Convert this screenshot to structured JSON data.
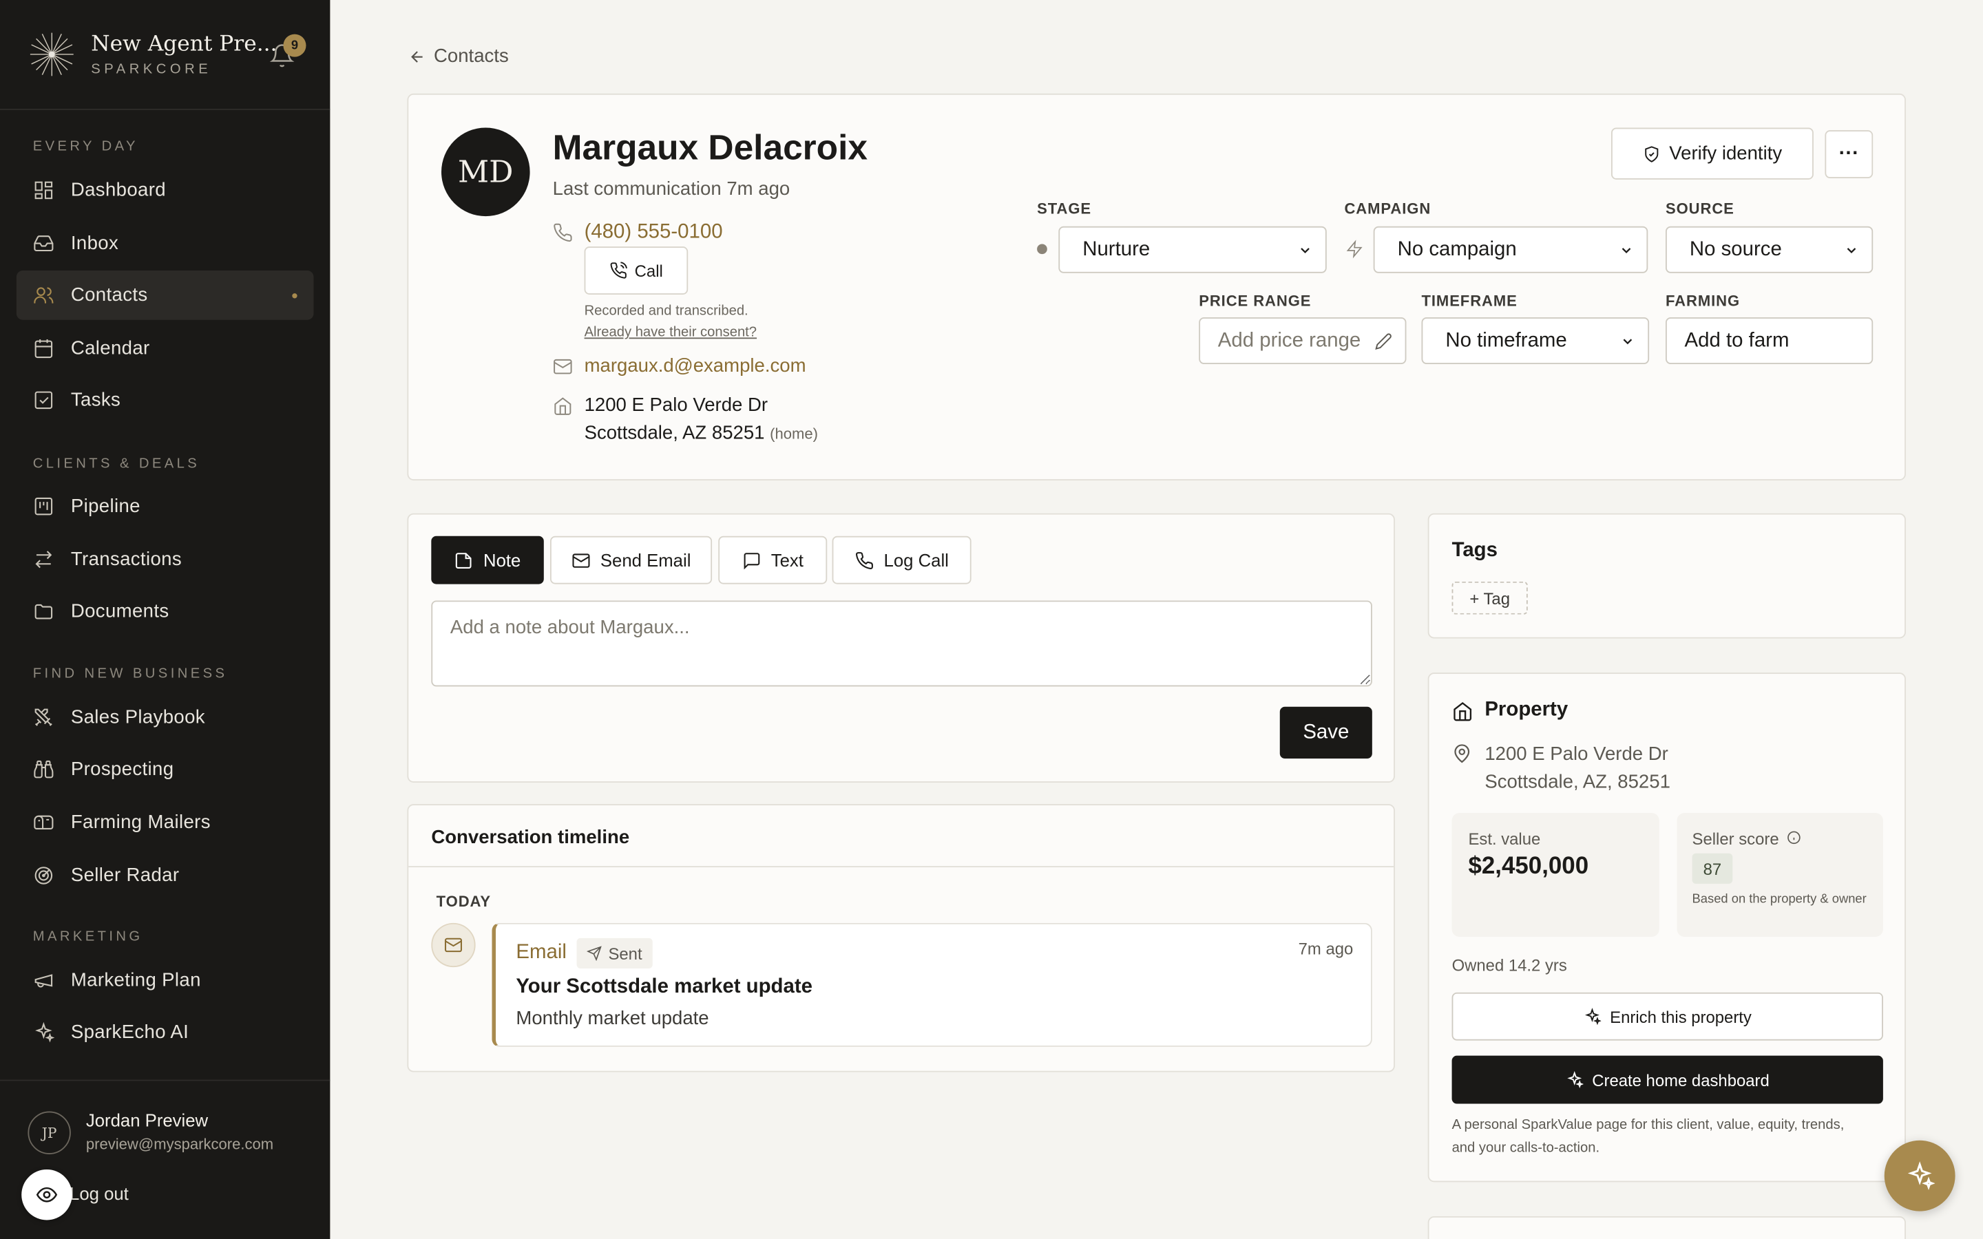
{
  "brand": {
    "name": "New Agent Pre...",
    "sub": "SPARKCORE",
    "notifications": "9"
  },
  "back_label": "Contacts",
  "nav": {
    "sections": [
      "EVERY DAY",
      "CLIENTS & DEALS",
      "FIND NEW BUSINESS",
      "MARKETING"
    ],
    "items": [
      {
        "label": "Dashboard",
        "icon": "dashboard-icon"
      },
      {
        "label": "Inbox",
        "icon": "inbox-icon"
      },
      {
        "label": "Contacts",
        "icon": "contacts-icon",
        "active": true
      },
      {
        "label": "Calendar",
        "icon": "calendar-icon"
      },
      {
        "label": "Tasks",
        "icon": "tasks-icon"
      },
      {
        "label": "Pipeline",
        "icon": "pipeline-icon"
      },
      {
        "label": "Transactions",
        "icon": "transactions-icon"
      },
      {
        "label": "Documents",
        "icon": "folder-icon"
      },
      {
        "label": "Sales Playbook",
        "icon": "swords-icon"
      },
      {
        "label": "Prospecting",
        "icon": "binoculars-icon"
      },
      {
        "label": "Farming Mailers",
        "icon": "mailbox-icon"
      },
      {
        "label": "Seller Radar",
        "icon": "radar-icon"
      },
      {
        "label": "Marketing Plan",
        "icon": "megaphone-icon"
      },
      {
        "label": "SparkEcho AI",
        "icon": "sparkles-icon"
      }
    ]
  },
  "user": {
    "initials": "JP",
    "name": "Jordan Preview",
    "email": "preview@mysparkcore.com",
    "logout": "Log out"
  },
  "contact": {
    "initials": "MD",
    "name": "Margaux Delacroix",
    "last_comm": "Last communication 7m ago",
    "phone": "(480) 555-0100",
    "call_label": "Call",
    "recorded": "Recorded and transcribed.",
    "consent": "Already have their consent?",
    "email": "margaux.d@example.com",
    "address_line1": "1200 E Palo Verde Dr",
    "address_line2": "Scottsdale, AZ 85251",
    "address_tag": "(home)",
    "verify_label": "Verify identity",
    "more_label": "···"
  },
  "fields": {
    "stage_label": "STAGE",
    "stage_value": "Nurture",
    "campaign_label": "CAMPAIGN",
    "campaign_value": "No campaign",
    "source_label": "SOURCE",
    "source_value": "No source",
    "price_label": "PRICE RANGE",
    "price_placeholder": "Add price range",
    "timeframe_label": "TIMEFRAME",
    "timeframe_value": "No timeframe",
    "farming_label": "FARMING",
    "farming_value": "Add to farm"
  },
  "composer": {
    "tabs": [
      "Note",
      "Send Email",
      "Text",
      "Log Call"
    ],
    "placeholder": "Add a note about Margaux...",
    "save_label": "Save"
  },
  "timeline": {
    "title": "Conversation timeline",
    "day": "TODAY",
    "entry": {
      "type": "Email",
      "status": "Sent",
      "time": "7m ago",
      "subject": "Your Scottsdale market update",
      "preview": "Monthly market update"
    }
  },
  "tags": {
    "title": "Tags",
    "add_label": "+ Tag"
  },
  "property": {
    "title": "Property",
    "address_line1": "1200 E Palo Verde Dr",
    "address_line2": "Scottsdale, AZ, 85251",
    "est_label": "Est. value",
    "est_value": "$2,450,000",
    "score_label": "Seller score",
    "score_value": "87",
    "score_note": "Based on the property & owner",
    "owned": "Owned 14.2 yrs",
    "enrich_label": "Enrich this property",
    "dashboard_label": "Create home dashboard",
    "dashboard_note": "A personal SparkValue page for this client, value, equity, trends, and your calls-to-action."
  },
  "colors": {
    "accent": "#a88a4e",
    "sidebar": "#1a1917",
    "link": "#8a6d33"
  }
}
